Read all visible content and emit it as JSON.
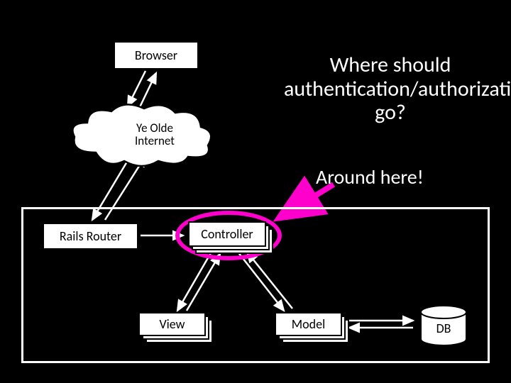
{
  "question": "Where should authentication/authorization go?",
  "answer": "Around here!",
  "nodes": {
    "browser": "Browser",
    "cloud": "Ye Olde\nInternet",
    "router": "Rails Router",
    "controller": "Controller",
    "view": "View",
    "model": "Model",
    "db": "DB"
  },
  "colors": {
    "highlight": "#ff00cc",
    "bg": "#000000",
    "box_fill": "#ffffff",
    "box_border": "#000000",
    "outer_border": "#ffffff"
  }
}
